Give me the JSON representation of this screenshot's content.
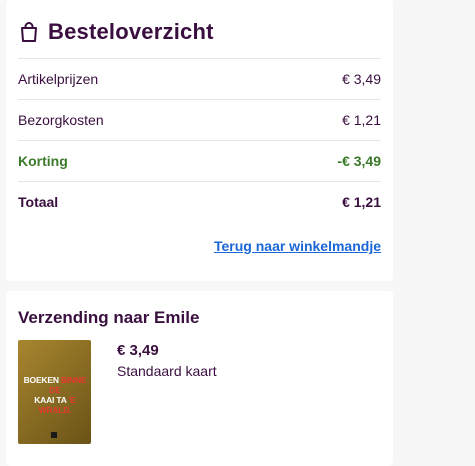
{
  "summary": {
    "title": "Besteloverzicht",
    "icon": "shopping-bag-icon",
    "rows": [
      {
        "label": "Artikelprijzen",
        "value": "€ 3,49"
      },
      {
        "label": "Bezorgkosten",
        "value": "€ 1,21"
      },
      {
        "label": "Korting",
        "value": "-€ 3,49"
      },
      {
        "label": "Totaal",
        "value": "€ 1,21"
      }
    ],
    "back_link": "Terug naar winkelmandje"
  },
  "shipping": {
    "title": "Verzending naar Emile",
    "item": {
      "price": "€ 3,49",
      "description": "Standaard kaart",
      "thumb_text_white_1": "BOEKEN",
      "thumb_text_red_1": "BINNE DE",
      "thumb_text_white_2": "KAAI TA ",
      "thumb_text_red_2": "'E WRALD."
    }
  },
  "colors": {
    "heading": "#3a0f3f",
    "discount": "#3b7a2a",
    "link": "#1a66d6"
  }
}
